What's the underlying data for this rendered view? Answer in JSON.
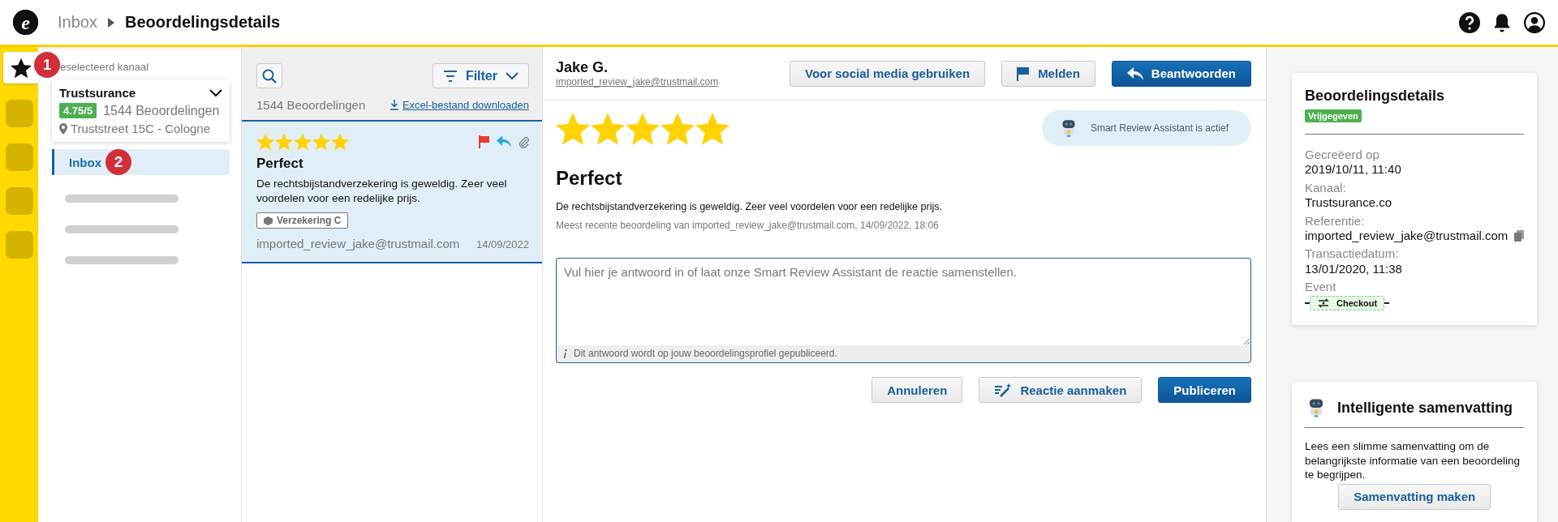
{
  "header": {
    "logo": "e",
    "breadcrumb": [
      {
        "label": "Inbox",
        "current": false
      },
      {
        "label": "Beoordelingsdetails",
        "current": true
      }
    ]
  },
  "rail": {
    "items": [
      {
        "selected": true,
        "marker": "1"
      },
      {
        "selected": false
      },
      {
        "selected": false
      },
      {
        "selected": false
      },
      {
        "selected": false
      }
    ]
  },
  "channel_panel": {
    "label": "eselecteerd kanaal",
    "channel": {
      "name": "Trustsurance",
      "rating": "4.75/5",
      "count": "1544 Beoordelingen",
      "address": "Truststreet 15C - Cologne"
    },
    "nav": [
      {
        "label": "Inbox",
        "selected": true,
        "marker": "2"
      }
    ],
    "skeleton_rows": [
      {
        "kind": "skeleton"
      },
      {
        "kind": "skeleton"
      },
      {
        "kind": "skeleton"
      }
    ]
  },
  "review_list": {
    "filter_button": "Filter",
    "count": "1544 Beoordelingen",
    "download_link": "Excel-bestand downloaden",
    "reviews": [
      {
        "stars": 5,
        "title": "Perfect",
        "text": "De rechtsbijstandverzekering is geweldig. Zeer veel voordelen voor een redelijke prijs.",
        "tag": "Verzekering C",
        "author": "imported_review_jake@trustmail.com",
        "date": "14/09/2022",
        "selected": true,
        "flagged": true,
        "replied": true,
        "attachment": true
      }
    ]
  },
  "detail": {
    "name": "Jake G.",
    "email": "imported_review_jake@trustmail.com",
    "buttons": [
      {
        "label": "Voor social media gebruiken",
        "kind": "secondary"
      },
      {
        "label": "Melden",
        "kind": "report"
      },
      {
        "label": "Beantwoorden",
        "kind": "reply"
      }
    ],
    "stars": 5,
    "assistant_status": "Smart Review Assistant is actief",
    "title": "Perfect",
    "text": "De rechtsbijstandverzekering is geweldig. Zeer veel voordelen voor een redelijke prijs.",
    "meta": "Meest recente beoordeling van imported_review_jake@trustmail.com, 14/09/2022, 18:06",
    "reply": {
      "placeholder": "Vul hier je antwoord in of laat onze Smart Review Assistant de reactie samenstellen.",
      "note": "Dit antwoord wordt op jouw beoordelingsprofiel gepubliceerd."
    },
    "actions": [
      {
        "label": "Annuleren",
        "kind": "secondary"
      },
      {
        "label": "Reactie aanmaken",
        "kind": "generate"
      },
      {
        "label": "Publiceren",
        "kind": "primary"
      }
    ]
  },
  "details_card": {
    "title": "Beoordelingsdetails",
    "status": "Vrijgegeven",
    "fields": [
      {
        "label": "Gecreëerd op",
        "value": "2019/10/11, 11:40",
        "copyable": false
      },
      {
        "label": "Kanaal:",
        "value": "Trustsurance.co",
        "copyable": false
      },
      {
        "label": "Referentie:",
        "value": "imported_review_jake@trustmail.com",
        "copyable": true
      },
      {
        "label": "Transactiedatum:",
        "value": "13/01/2020, 11:38",
        "copyable": false
      }
    ],
    "event": {
      "label": "Event",
      "value": "Checkout"
    }
  },
  "summary_card": {
    "title": "Intelligente samenvatting",
    "text": "Lees een slimme samenvatting om de belangrijkste informatie van een beoordeling te begrijpen.",
    "button": "Samenvatting maken"
  }
}
